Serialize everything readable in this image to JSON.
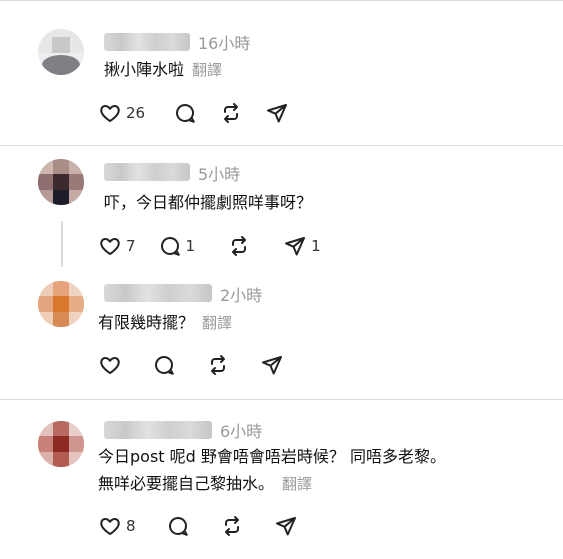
{
  "actions_labels": {
    "like": "like",
    "reply": "reply",
    "repost": "repost",
    "share": "share"
  },
  "posts": [
    {
      "time": "16小時",
      "text": "揪小陣水啦",
      "translate": "翻譯",
      "likes": "26",
      "replies": "",
      "reposts": ""
    },
    {
      "time": "5小時",
      "text": "吓，今日都仲擺劇照咩事呀？",
      "translate": "",
      "likes": "7",
      "replies": "1",
      "shares": "1"
    },
    {
      "time": "2小時",
      "text": "有限幾時擺？",
      "translate": "翻譯",
      "likes": "",
      "replies": ""
    },
    {
      "time": "6小時",
      "text_line1": "今日post 呢d 野會唔會唔岩時候？ 同唔多老黎。",
      "text_line2": "無咩必要擺自己黎抽水。",
      "translate": "翻譯",
      "likes": "8"
    }
  ]
}
